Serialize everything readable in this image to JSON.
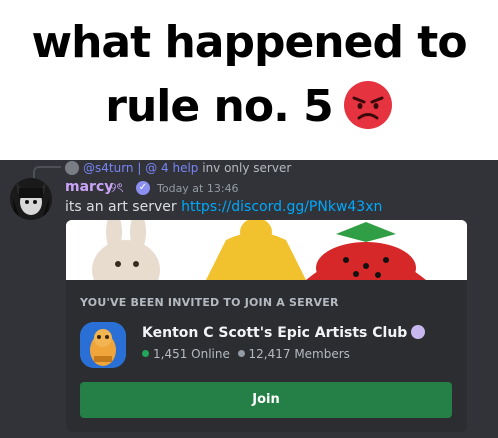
{
  "caption": {
    "line1": "what happened to",
    "line2": "rule no. 5"
  },
  "reply": {
    "mention": "@s4turn | @ 4 help",
    "text": "inv only server"
  },
  "message": {
    "username": "marcy",
    "username_tag": "୨ৎ",
    "timestamp": "Today at 13:46",
    "text": "its an art server",
    "link": "https://discord.gg/PNkw43xn"
  },
  "invite": {
    "header": "YOU'VE BEEN INVITED TO JOIN A SERVER",
    "server_name": "Kenton C Scott's Epic Artists Club",
    "online": "1,451 Online",
    "members": "12,417 Members",
    "join_label": "Join"
  },
  "colors": {
    "background": "#313338",
    "embed": "#2b2d31",
    "join": "#248046",
    "link": "#00a8fc",
    "username": "#c9a4f6",
    "online_dot": "#23a55a",
    "members_dot": "#949ba4"
  },
  "icons": [
    "angry-face-icon",
    "verified-badge-icon",
    "server-badge-icon"
  ]
}
